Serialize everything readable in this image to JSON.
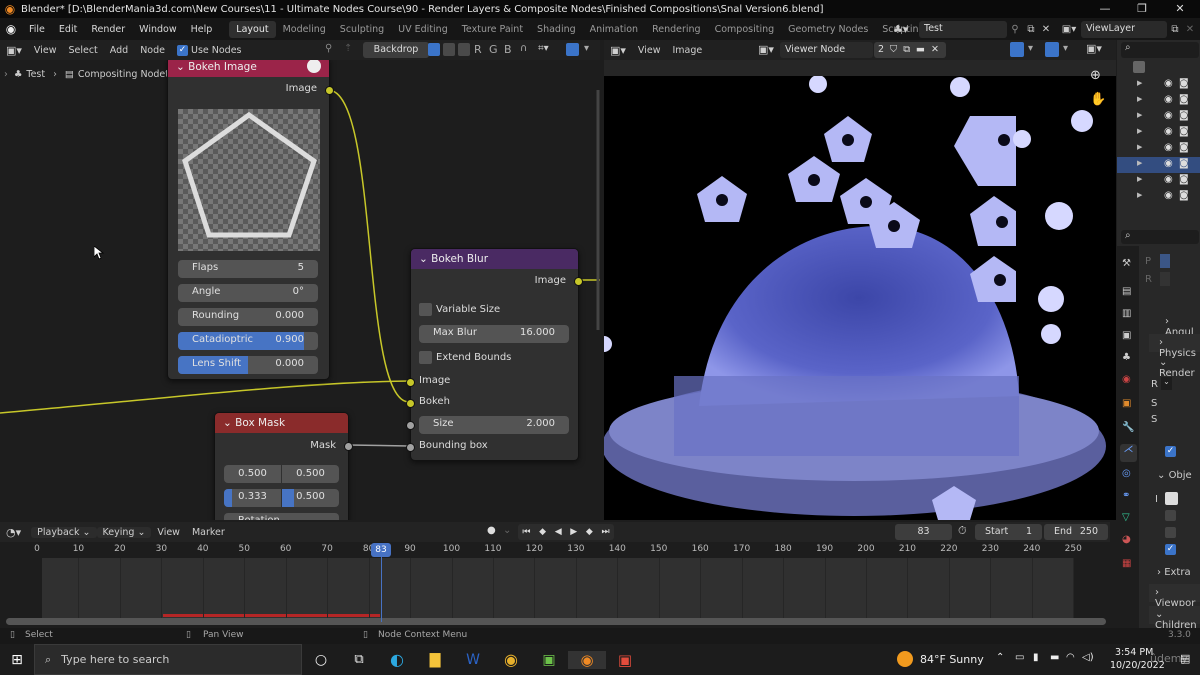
{
  "window": {
    "title": "Blender* [D:\\BlenderMania3d.com\\New Courses\\11 - Ultimate Nodes Course\\90 - Render Layers & Composite Nodes\\Finished Compositions\\Snal Version6.blend]",
    "minimize": "—",
    "maximize": "❐",
    "close": "✕"
  },
  "menu": {
    "items": [
      "File",
      "Edit",
      "Render",
      "Window",
      "Help"
    ],
    "workspaces": [
      "Layout",
      "Modeling",
      "Sculpting",
      "UV Editing",
      "Texture Paint",
      "Shading",
      "Animation",
      "Rendering",
      "Compositing",
      "Geometry Nodes",
      "Scripting"
    ],
    "active_workspace": "Layout",
    "add_workspace": "+",
    "scene": "Test",
    "view_layer": "ViewLayer"
  },
  "node_editor": {
    "header": {
      "menus": [
        "View",
        "Select",
        "Add",
        "Node"
      ],
      "use_nodes_label": "Use Nodes",
      "use_nodes_checked": true,
      "backdrop_label": "Backdrop",
      "channels": [
        "R",
        "G",
        "B"
      ]
    },
    "breadcrumb": [
      "Test",
      "Compositing Nodetree"
    ],
    "nodes": {
      "bokeh_image": {
        "title": "Bokeh Image",
        "output": "Image",
        "fields": [
          {
            "label": "Flaps",
            "value": "5",
            "fill": 0
          },
          {
            "label": "Angle",
            "value": "0°",
            "fill": 0
          },
          {
            "label": "Rounding",
            "value": "0.000",
            "fill": 0
          },
          {
            "label": "Catadioptric",
            "value": "0.900",
            "fill": 0.9
          },
          {
            "label": "Lens Shift",
            "value": "0.000",
            "fill": 0.5
          }
        ]
      },
      "bokeh_blur": {
        "title": "Bokeh Blur",
        "output": "Image",
        "variable_size_label": "Variable Size",
        "max_blur_label": "Max Blur",
        "max_blur_value": "16.000",
        "extend_bounds_label": "Extend Bounds",
        "inputs": [
          "Image",
          "Bokeh"
        ],
        "size_label": "Size",
        "size_value": "2.000",
        "bounding_box_label": "Bounding box"
      },
      "box_mask": {
        "title": "Box Mask",
        "output": "Mask",
        "row1": [
          "0.500",
          "0.500"
        ],
        "row2": [
          "0.333",
          "0.500"
        ],
        "row3_partial": "Rotation"
      }
    }
  },
  "image_editor": {
    "header": {
      "menus": [
        "View",
        "Image"
      ],
      "image_name": "Viewer Node",
      "users": "2"
    }
  },
  "outliner": {
    "rows": 8,
    "selected_row": 5
  },
  "properties": {
    "labels": [
      "P",
      "R",
      "Angul",
      "Physics",
      "Render",
      "R",
      "S",
      "S",
      "Obje",
      "I",
      "Extra",
      "Viewpor",
      "Children"
    ]
  },
  "timeline": {
    "menus": [
      "Playback",
      "Keying",
      "View",
      "Marker"
    ],
    "current_frame": "83",
    "start_label": "Start",
    "start": "1",
    "end_label": "End",
    "end": "250",
    "ticks": [
      "0",
      "10",
      "20",
      "30",
      "40",
      "50",
      "60",
      "70",
      "80",
      "90",
      "100",
      "110",
      "120",
      "130",
      "140",
      "150",
      "160",
      "170",
      "180",
      "190",
      "200",
      "210",
      "220",
      "230",
      "240",
      "250"
    ]
  },
  "status": {
    "select": "Select",
    "pan": "Pan View",
    "context": "Node Context Menu",
    "version": "3.3.0"
  },
  "taskbar": {
    "search_placeholder": "Type here to search",
    "weather": "84°F  Sunny",
    "time": "3:54 PM",
    "date": "10/20/2022",
    "watermark": "ûdemy"
  }
}
